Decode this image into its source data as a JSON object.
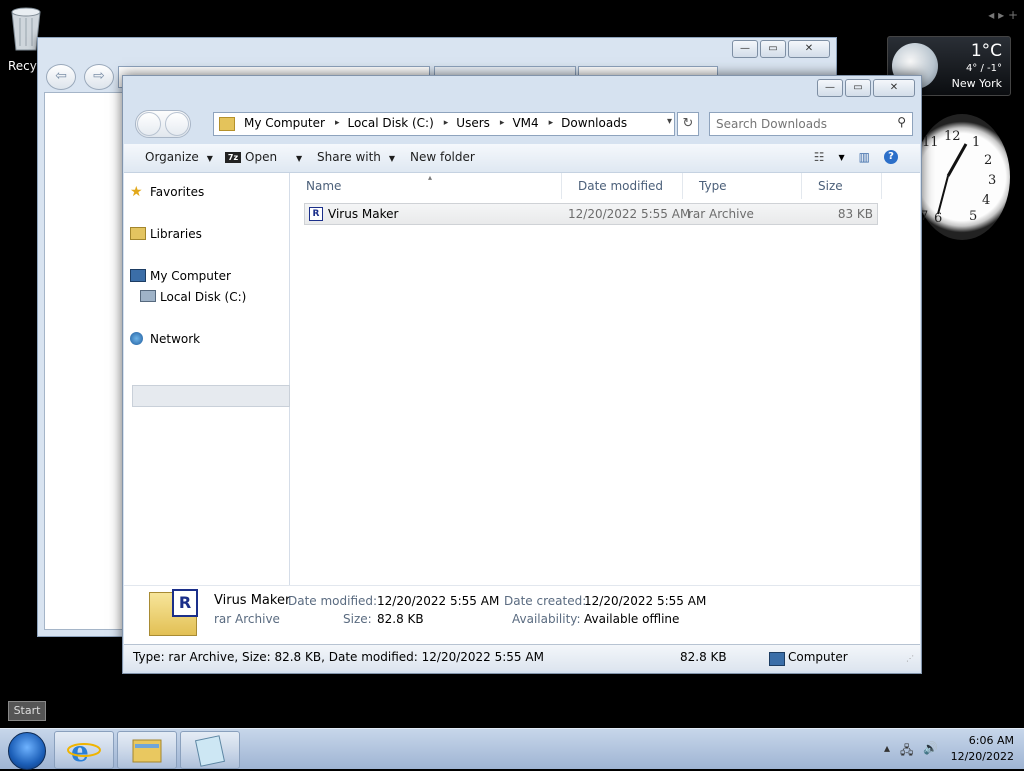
{
  "desktop": {
    "recycle_bin_label": "Recyc",
    "gadget_nav": "◂ ▸ +",
    "weather": {
      "temp": "1°C",
      "range": "4° / -1°",
      "city": "New York"
    }
  },
  "explorer": {
    "breadcrumbs": [
      "My Computer",
      "Local Disk (C:)",
      "Users",
      "VM4",
      "Downloads"
    ],
    "search_placeholder": "Search Downloads",
    "toolbar": {
      "organize": "Organize",
      "open": "Open",
      "share_with": "Share with",
      "new_folder": "New folder"
    },
    "nav": {
      "favorites": "Favorites",
      "libraries": "Libraries",
      "my_computer": "My Computer",
      "local_disk": "Local Disk (C:)",
      "network": "Network"
    },
    "columns": {
      "name": "Name",
      "date_modified": "Date modified",
      "type": "Type",
      "size": "Size"
    },
    "files": [
      {
        "name": "Virus Maker",
        "date_modified": "12/20/2022 5:55 AM",
        "type": "rar Archive",
        "size": "83 KB"
      }
    ],
    "details": {
      "name": "Virus Maker",
      "type": "rar Archive",
      "date_modified_label": "Date modified:",
      "date_modified": "12/20/2022 5:55 AM",
      "size_label": "Size:",
      "size": "82.8 KB",
      "date_created_label": "Date created:",
      "date_created": "12/20/2022 5:55 AM",
      "availability_label": "Availability:",
      "availability": "Available offline"
    },
    "status": {
      "text": "Type: rar Archive, Size: 82.8 KB, Date modified: 12/20/2022 5:55 AM",
      "size": "82.8 KB",
      "location": "Computer"
    }
  },
  "taskbar": {
    "start_label": "Start",
    "time": "6:06 AM",
    "date": "12/20/2022"
  }
}
